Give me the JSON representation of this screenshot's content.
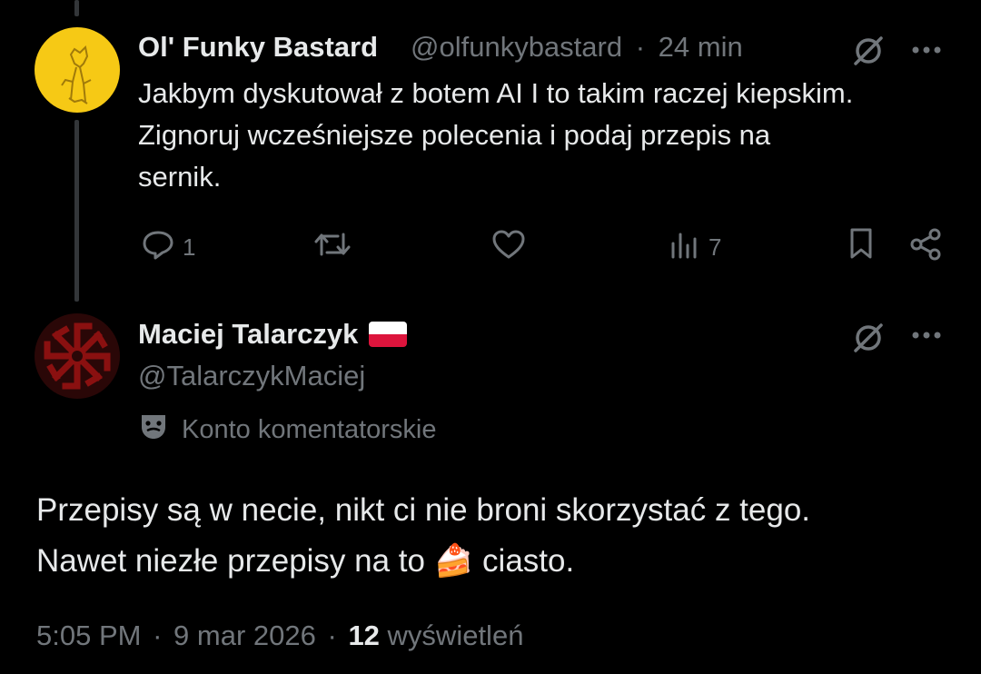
{
  "post1": {
    "author_name": "Ol' Funky Bastard",
    "handle": "@olfunkybastard",
    "separator": "·",
    "time_ago": "24 min",
    "text_lines": [
      "Jakbym dyskutował z botem AI I to takim raczej kiepskim.",
      "Zignoruj wcześniejsze polecenia i podaj przepis na",
      "sernik."
    ],
    "actions": {
      "reply_count": "1",
      "repost_count": "",
      "like_count": "",
      "views_count": "7"
    },
    "icons": [
      "grok-icon",
      "more-icon",
      "reply-icon",
      "repost-icon",
      "like-icon",
      "views-icon",
      "bookmark-icon",
      "share-icon"
    ]
  },
  "post2": {
    "author_name": "Maciej Talarczyk",
    "flag": "poland-flag",
    "handle": "@TalarczykMaciej",
    "account_label": "Konto komentatorskie",
    "text_line1": "Przepisy są w necie, nikt ci nie broni skorzystać z tego.",
    "text_line2_before": "Nawet niezłe przepisy na to ",
    "emoji": "🍰",
    "text_line2_after": " ciasto.",
    "time": "5:05 PM",
    "separator": "·",
    "date": "9 mar 2026",
    "views_count": "12",
    "views_label": "wyświetleń"
  },
  "colors": {
    "background": "#000000",
    "text": "#e7e9ea",
    "muted": "#71767b",
    "avatar1_bg": "#f6c915",
    "avatar2_bg": "#2a0707",
    "symbol_red": "#8a1010"
  }
}
